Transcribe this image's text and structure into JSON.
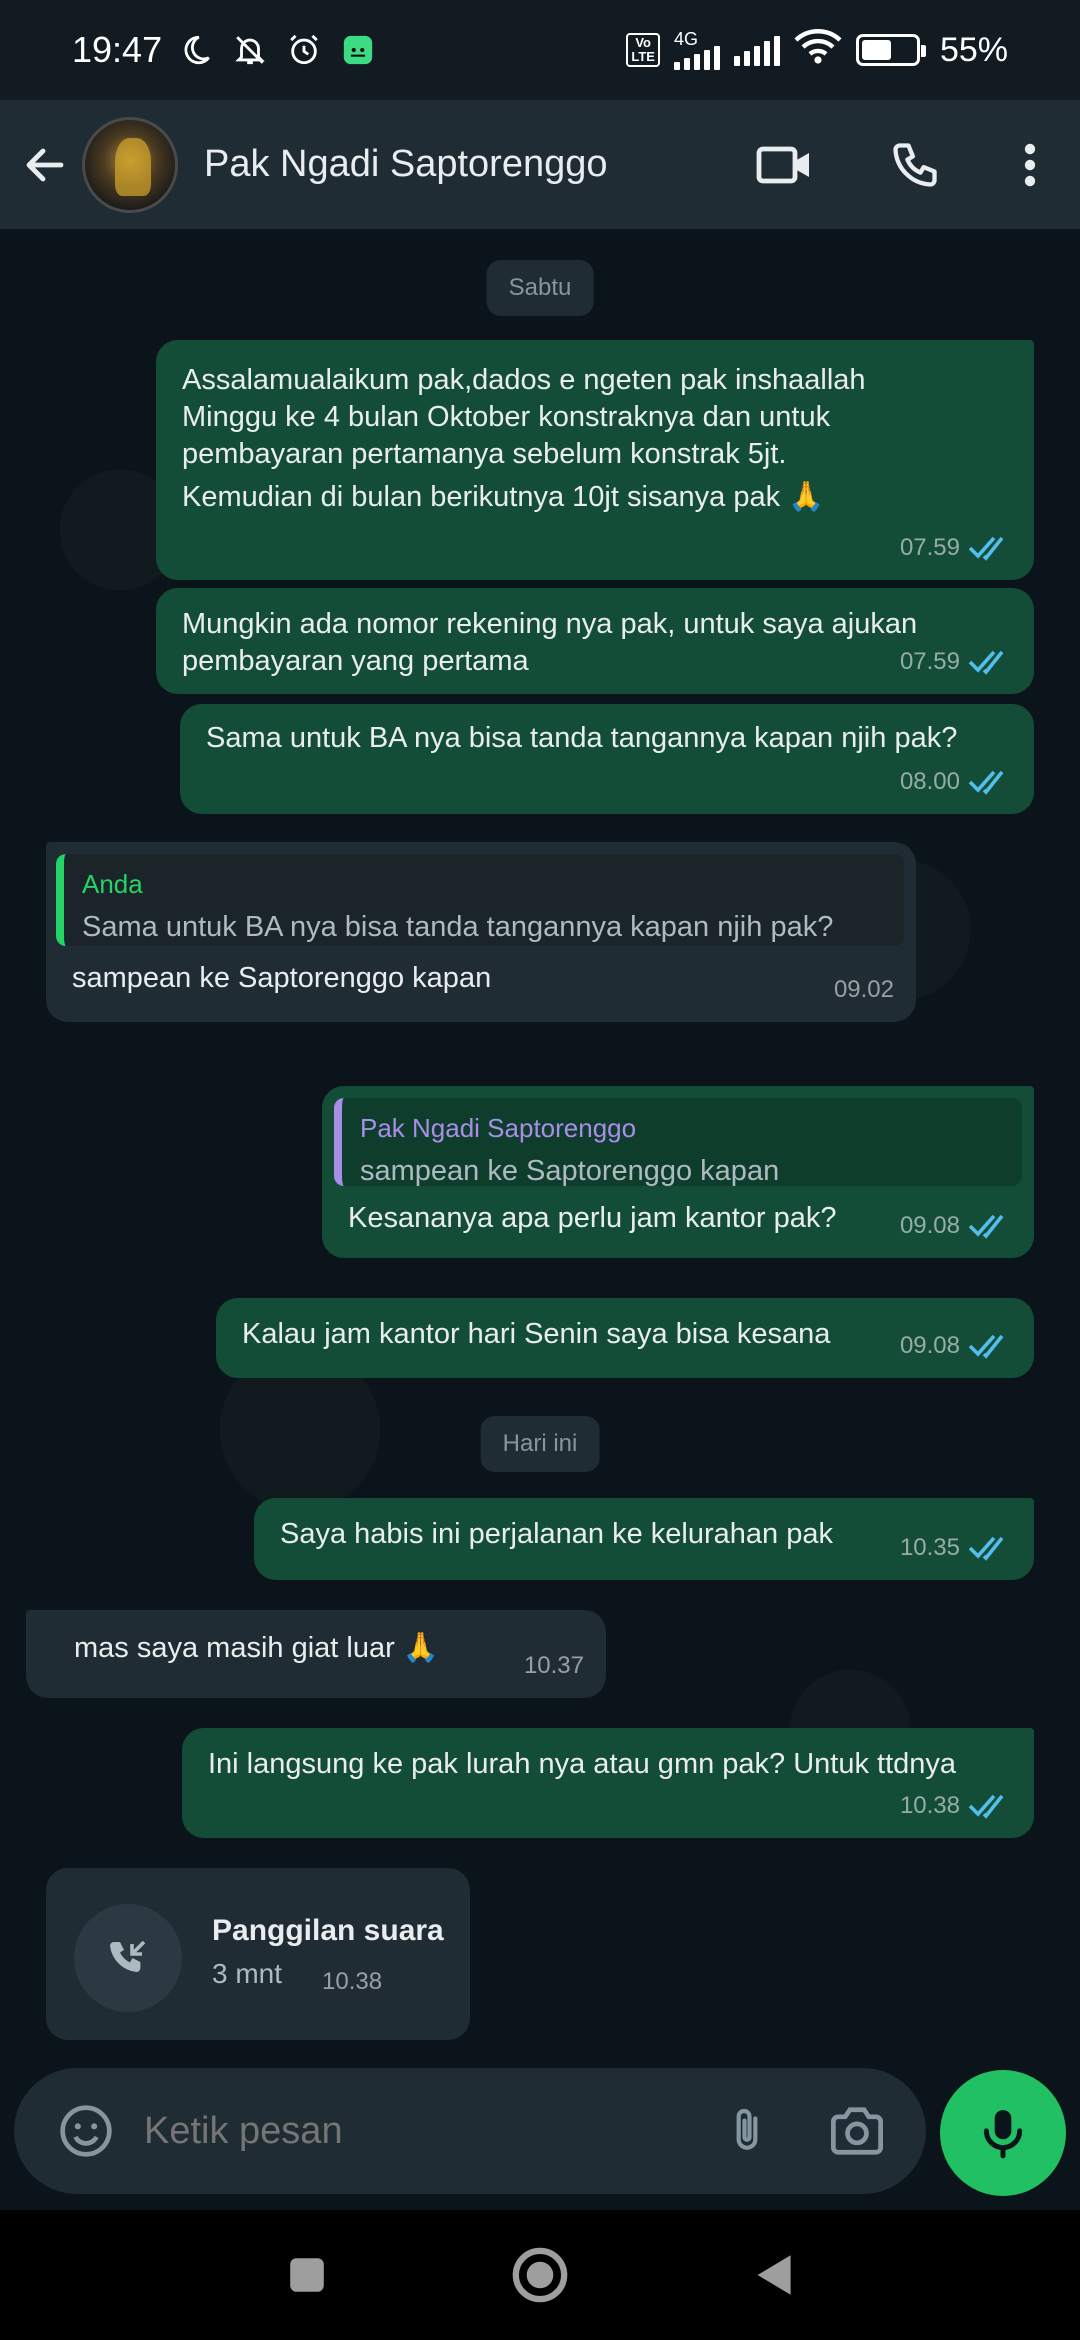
{
  "status_bar": {
    "time": "19:47",
    "network": "4G",
    "volte": "VoLTE",
    "battery": "55%",
    "battery_level": 0.55
  },
  "header": {
    "contact_name": "Pak Ngadi Saptorenggo"
  },
  "chips": {
    "saturday": "Sabtu",
    "today": "Hari ini"
  },
  "messages": [
    {
      "direction": "out",
      "lines": [
        "Assalamualaikum pak,dados e ngeten pak inshaallah",
        "Minggu ke 4 bulan Oktober konstraknya dan untuk",
        "pembayaran pertamanya sebelum konstrak 5jt.",
        "Kemudian di bulan berikutnya 10jt sisanya pak 🙏"
      ],
      "time": "07.59"
    },
    {
      "direction": "out",
      "lines": [
        "Mungkin ada nomor rekening nya pak, untuk saya ajukan",
        "pembayaran yang pertama"
      ],
      "time": "07.59"
    },
    {
      "direction": "out",
      "lines": [
        "Sama untuk BA nya bisa tanda tangannya kapan njih pak?"
      ],
      "time": "08.00"
    },
    {
      "direction": "in",
      "quote_name": "Anda",
      "quote_text": "Sama untuk BA nya bisa tanda tangannya kapan njih pak?",
      "lines": [
        "sampean ke Saptorenggo kapan"
      ],
      "time": "09.02"
    },
    {
      "direction": "out",
      "quote_name": "Pak Ngadi Saptorenggo",
      "quote_text": "sampean ke Saptorenggo kapan",
      "lines": [
        "Kesananya apa perlu jam kantor pak?"
      ],
      "time": "09.08"
    },
    {
      "direction": "out",
      "lines": [
        "Kalau jam kantor hari Senin saya bisa kesana"
      ],
      "time": "09.08"
    },
    {
      "direction": "out",
      "lines": [
        "Saya habis ini perjalanan ke kelurahan pak"
      ],
      "time": "10.35"
    },
    {
      "direction": "in",
      "lines": [
        "mas saya masih giat luar 🙏"
      ],
      "time": "10.37"
    },
    {
      "direction": "out",
      "lines": [
        "Ini langsung ke pak lurah nya atau gmn pak? Untuk ttdnya"
      ],
      "time": "10.38"
    }
  ],
  "call": {
    "title": "Panggilan suara",
    "duration": "3 mnt",
    "time": "10.38"
  },
  "input": {
    "placeholder": "Ketik pesan"
  },
  "colors": {
    "outgoing_bubble": "#144d37",
    "incoming_bubble": "#1f2c33",
    "read_ticks": "#53bdeb",
    "mic_button": "#21c063",
    "quote_self": "#25d366",
    "quote_contact": "#a98ee7"
  },
  "icons": {
    "back": "arrow-left-icon",
    "video": "video-camera-icon",
    "call": "phone-icon",
    "menu": "more-vert-icon",
    "emoji": "emoji-icon",
    "attach": "paperclip-icon",
    "camera": "camera-icon",
    "mic": "mic-icon",
    "missed_call": "incoming-call-icon"
  }
}
